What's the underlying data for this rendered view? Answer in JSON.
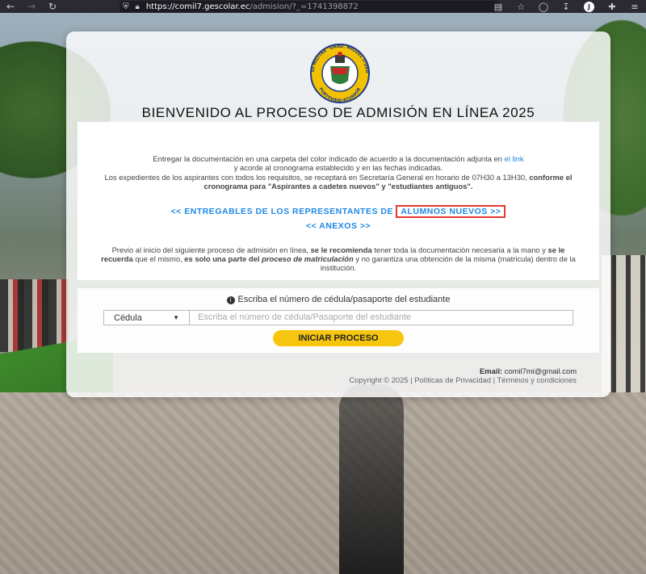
{
  "browser": {
    "url_host": "https://comil7.gescolar.ec",
    "url_path": "/admision/?_=1741398872",
    "profile_initial": "J",
    "icons": [
      "back-icon",
      "forward-icon",
      "reload-icon",
      "shield-icon",
      "lock-icon",
      "reader-icon",
      "star-icon",
      "pocket-icon",
      "download-icon",
      "extensions-icon",
      "menu-icon"
    ]
  },
  "seal": {
    "ring_text_top": "COLEGIO MILITAR \"GRAD. MIGUEL ITURRALDE\"",
    "ring_text_bottom": "PORTOVIEJO-ECUADOR",
    "colors": {
      "ring": "#f2c200",
      "border": "#1f3c8a",
      "inner": "#ffffff"
    }
  },
  "heading": "BIENVENIDO AL PROCESO DE ADMISIÓN EN LÍNEA 2025",
  "intro": {
    "line1_before": "Entregar la documentación en una carpeta del color indicado de acuerdo a la documentación adjunta en ",
    "link_text": "el link",
    "line1_after": " y acorde al cronograma establecido y en las fechas indicadas.",
    "line2_plain": "Los expedientes de los aspirantes con todos los requisitos, se receptará en Secretaría General en horario de 07H30 a 13H30, ",
    "line2_bold": "conforme el cronograma para \"Aspirantes a cadetes nuevos\" y \"estudiantes antiguos\"."
  },
  "links": {
    "deliverables_prefix": "<< ENTREGABLES DE LOS REPRESENTANTES DE ",
    "deliverables_highlight": "ALUMNOS NUEVOS >>",
    "annexes": "<< ANEXOS >>"
  },
  "notice": {
    "t1": "Previo al inicio del siguiente proceso de admisión en línea, ",
    "b1": "se le recomienda",
    "t2": " tener toda la documentación necesaria a la mano y ",
    "b2": "se le recuerda",
    "t3": " que el mismo, ",
    "b3": "es solo una parte del",
    "i1": "proceso de matriculación",
    "t4": " y no garantiza una obtención de la misma (matricula) dentro de la institución."
  },
  "form": {
    "prompt": "Escriba el número de cédula/pasaporte del estudiante",
    "doc_type_selected": "Cédula",
    "id_placeholder": "Escriba el número de cédula/Pasaporte del estudiante",
    "submit_label": "INICIAR PROCESO"
  },
  "footer": {
    "email_label": "Email:",
    "email_value": "comil7mi@gmail.com",
    "copyright": "Copyright © 2025 | Políticas de Privacidad | Términos y condiciones"
  },
  "colors": {
    "accent_link": "#1e88e5",
    "button": "#f6c50e",
    "highlight_box": "#e53935"
  }
}
